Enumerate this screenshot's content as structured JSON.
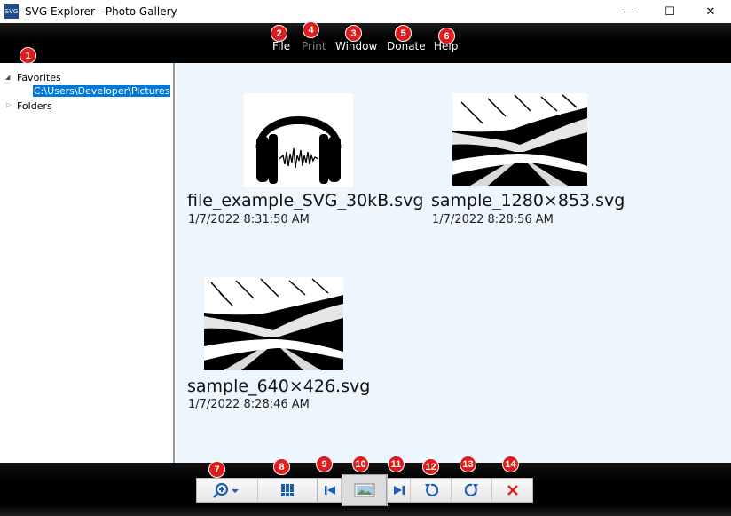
{
  "window": {
    "icon_text": "SVG",
    "title": "SVG Explorer - Photo Gallery",
    "minimize": "—",
    "maximize": "☐",
    "close": "✕"
  },
  "menu": {
    "items": [
      {
        "label": "File",
        "enabled": true
      },
      {
        "label": "Print",
        "enabled": false
      },
      {
        "label": "Window",
        "enabled": true
      },
      {
        "label": "Donate",
        "enabled": true
      },
      {
        "label": "Help",
        "enabled": true
      }
    ]
  },
  "tree": {
    "favorites_label": "Favorites",
    "favorites_path": "C:\\Users\\Developer\\Pictures",
    "folders_label": "Folders"
  },
  "gallery": {
    "items": [
      {
        "name": "file_example_SVG_30kB.svg",
        "date": "1/7/2022 8:31:50 AM"
      },
      {
        "name": "sample_1280×853.svg",
        "date": "1/7/2022 8:28:56 AM"
      },
      {
        "name": "sample_640×426.svg",
        "date": "1/7/2022 8:28:46 AM"
      }
    ]
  },
  "badges": [
    "1",
    "2",
    "3",
    "4",
    "5",
    "6",
    "7",
    "8",
    "9",
    "10",
    "11",
    "12",
    "13",
    "14"
  ],
  "colors": {
    "badge": "#e01b1b",
    "selection": "#0078d7",
    "gallery_bg": "#eef6fd",
    "toolbar_icon": "#1a5fb4",
    "delete_icon": "#d9202a"
  },
  "toolbar": {
    "icons": [
      "zoom-in-icon",
      "grid-view-icon",
      "first-image-icon",
      "slideshow-icon",
      "last-image-icon",
      "rotate-left-icon",
      "rotate-right-icon",
      "delete-icon"
    ]
  }
}
